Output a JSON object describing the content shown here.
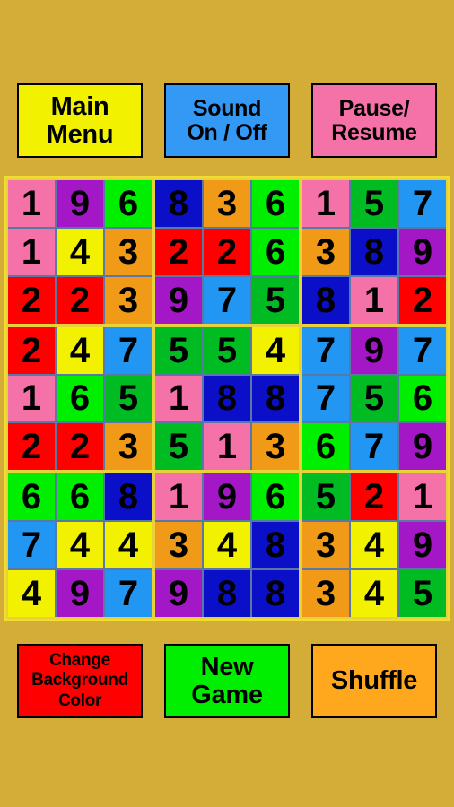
{
  "background_color": "#D4AC38",
  "top_buttons": [
    {
      "name": "main-menu",
      "lines": [
        "Main",
        "Menu"
      ],
      "bg": "#F2F200",
      "size": "btn-big"
    },
    {
      "name": "sound-toggle",
      "lines": [
        "Sound",
        "On / Off"
      ],
      "bg": "#3399F5",
      "size": "btn-mid"
    },
    {
      "name": "pause-resume",
      "lines": [
        "Pause/",
        "Resume"
      ],
      "bg": "#F472A8",
      "size": "btn-mid"
    }
  ],
  "bottom_buttons": [
    {
      "name": "change-background-color",
      "lines": [
        "Change",
        "Background",
        "Color"
      ],
      "bg": "#FF0000",
      "size": "btn-small"
    },
    {
      "name": "new-game",
      "lines": [
        "New",
        "Game"
      ],
      "bg": "#00EE00",
      "size": "btn-big"
    },
    {
      "name": "shuffle",
      "lines": [
        "Shuffle"
      ],
      "bg": "#FFA81E",
      "size": "btn-big"
    }
  ],
  "grid": {
    "border_color": "#F2DD2E",
    "box_separator_color": "#E8D13A",
    "cell_separator_color": "#5878A8",
    "digit_color": "#000000",
    "digit_colors": {
      "1": "#F472A8",
      "2": "#FF0000",
      "3": "#F09A18",
      "4": "#F2F200",
      "5": "#00BB22",
      "6": "#00EE00",
      "7": "#2196F3",
      "8": "#0B10C8",
      "9": "#A317C6"
    },
    "rows": [
      [
        1,
        9,
        6,
        8,
        3,
        6,
        1,
        5,
        7
      ],
      [
        1,
        4,
        3,
        2,
        2,
        6,
        3,
        8,
        9
      ],
      [
        2,
        2,
        3,
        9,
        7,
        5,
        8,
        1,
        2
      ],
      [
        2,
        4,
        7,
        5,
        5,
        4,
        7,
        9,
        7
      ],
      [
        1,
        6,
        5,
        1,
        8,
        8,
        7,
        5,
        6
      ],
      [
        2,
        2,
        3,
        5,
        1,
        3,
        6,
        7,
        9
      ],
      [
        6,
        6,
        8,
        1,
        9,
        6,
        5,
        2,
        1
      ],
      [
        7,
        4,
        4,
        3,
        4,
        8,
        3,
        4,
        9
      ],
      [
        4,
        9,
        7,
        9,
        8,
        8,
        3,
        4,
        5
      ]
    ]
  }
}
